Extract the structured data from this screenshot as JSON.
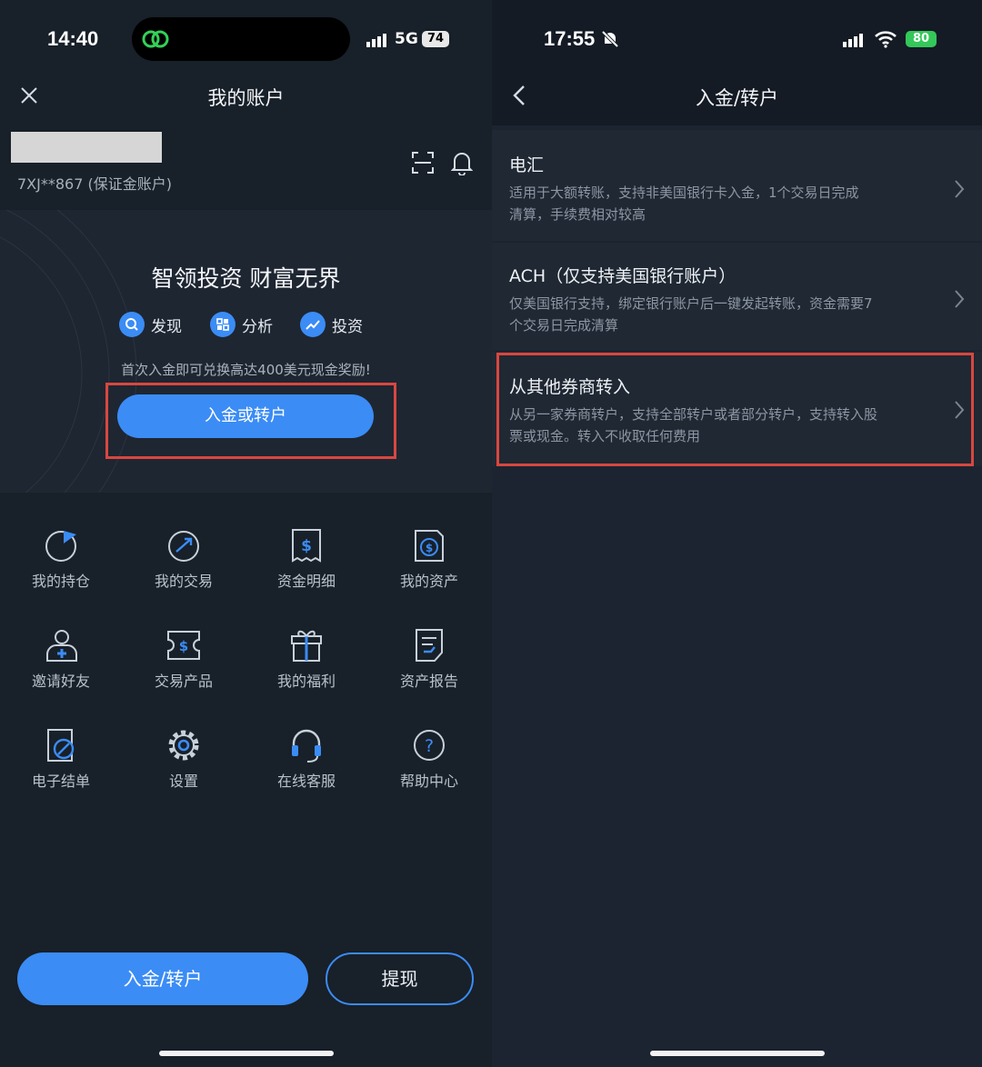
{
  "left": {
    "status": {
      "time": "14:40",
      "network": "5G",
      "battery": "74"
    },
    "nav": {
      "title": "我的账户",
      "close_icon": "close-icon"
    },
    "account": {
      "id_text": "7XJ**867 (保证金账户)"
    },
    "banner": {
      "headline": "智领投资 财富无界",
      "pills": [
        {
          "icon": "search-icon",
          "label": "发现"
        },
        {
          "icon": "grid-icon",
          "label": "分析"
        },
        {
          "icon": "trend-icon",
          "label": "投资"
        }
      ],
      "promo": "首次入金即可兑换高达400美元现金奖励!",
      "cta": "入金或转户"
    },
    "grid": [
      {
        "icon": "pie-chart-icon",
        "label": "我的持仓"
      },
      {
        "icon": "trade-icon",
        "label": "我的交易"
      },
      {
        "icon": "dollar-receipt-icon",
        "label": "资金明细"
      },
      {
        "icon": "asset-icon",
        "label": "我的资产"
      },
      {
        "icon": "invite-user-icon",
        "label": "邀请好友"
      },
      {
        "icon": "product-ticket-icon",
        "label": "交易产品"
      },
      {
        "icon": "gift-icon",
        "label": "我的福利"
      },
      {
        "icon": "report-icon",
        "label": "资产报告"
      },
      {
        "icon": "e-statement-icon",
        "label": "电子结单"
      },
      {
        "icon": "gear-icon",
        "label": "设置"
      },
      {
        "icon": "headset-icon",
        "label": "在线客服"
      },
      {
        "icon": "help-icon",
        "label": "帮助中心"
      }
    ],
    "bottom": {
      "deposit": "入金/转户",
      "withdraw": "提现"
    },
    "colors": {
      "accent": "#3b8cf5",
      "highlight": "#d9473f"
    }
  },
  "right": {
    "status": {
      "time": "17:55",
      "battery": "80"
    },
    "nav": {
      "title": "入金/转户",
      "back_icon": "chevron-left-icon"
    },
    "options": [
      {
        "title": "电汇",
        "desc": [
          "适用于大额转账，支持非美国银行卡入金，1个交易日完成",
          "清算，手续费相对较高"
        ]
      },
      {
        "title": "ACH（仅支持美国银行账户）",
        "desc": [
          "仅美国银行支持，绑定银行账户后一键发起转账，资金需要7",
          "个交易日完成清算"
        ]
      },
      {
        "title": "从其他券商转入",
        "desc": [
          "从另一家券商转户，支持全部转户或者部分转户，支持转入股",
          "票或现金。转入不收取任何费用"
        ]
      }
    ]
  }
}
